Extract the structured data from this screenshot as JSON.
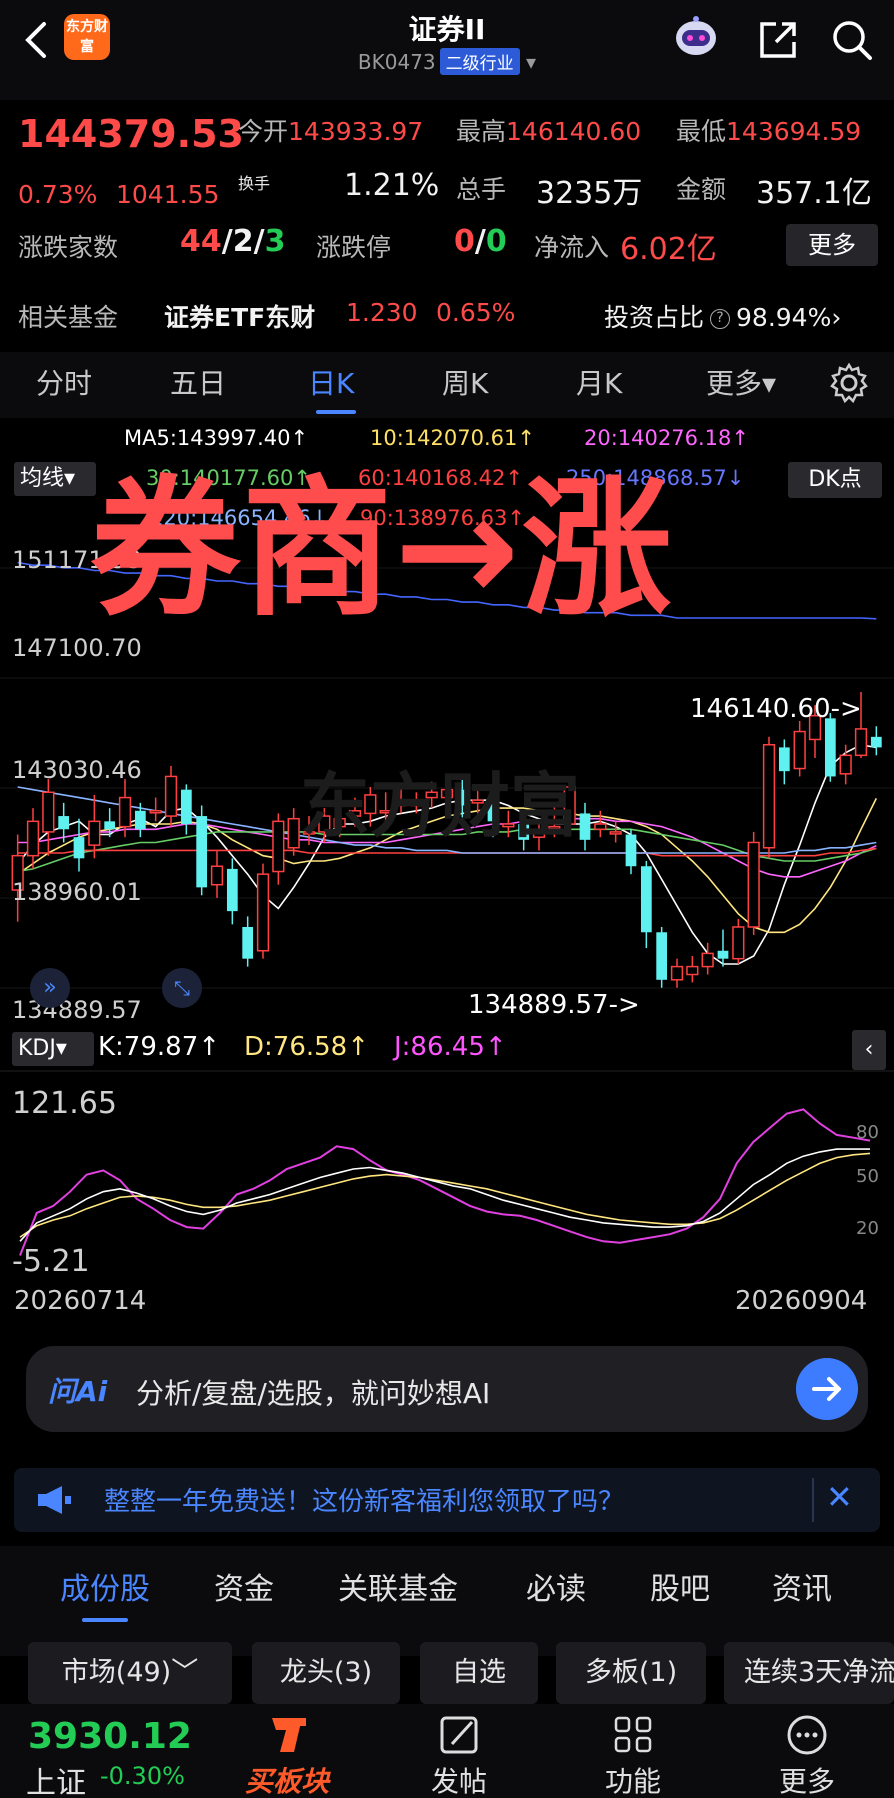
{
  "header": {
    "title": "证券II",
    "code": "BK0473",
    "tag": "二级行业",
    "logo_text": "东方财富"
  },
  "quote": {
    "price": "144379.53",
    "change_pct": "0.73%",
    "change_abs": "1041.55",
    "open_label": "今开",
    "open": "143933.97",
    "high_label": "最高",
    "high": "146140.60",
    "low_label": "最低",
    "low": "143694.59",
    "turnover_label": "换手",
    "turnover": "1.21%",
    "volume_label": "总手",
    "volume": "3235万",
    "amount_label": "金额",
    "amount": "357.1亿",
    "updown_label": "涨跌家数",
    "up": "44",
    "sep1": "/",
    "flat": "2",
    "sep2": "/",
    "down": "3",
    "limit_label": "涨跌停",
    "limit_up": "0",
    "sep3": "/",
    "limit_down": "0",
    "inflow_label": "净流入",
    "inflow": "6.02亿",
    "more_label": "更多",
    "fund_label": "相关基金",
    "fund_name": "证券ETF东财",
    "fund_price": "1.230",
    "fund_pct": "0.65%",
    "ratio_label": "投资占比",
    "ratio_q": "?",
    "ratio": "98.94%",
    "ratio_arrow": "›"
  },
  "period_tabs": [
    "分时",
    "五日",
    "日K",
    "周K",
    "月K",
    "更多▾"
  ],
  "chart": {
    "avg_label": "均线▾",
    "dk_label": "DK点",
    "ma_row1": [
      "MA5:143997.40↑",
      "10:142070.61↑",
      "20:140276.18↑"
    ],
    "ma_row2": [
      "30:140177.60↑",
      "60:140168.42↑",
      "250:148868.57↓"
    ],
    "ma_row3": [
      "120:146654.46↓",
      "90:138976.63↑"
    ],
    "y_labels": [
      "151171.53",
      "147100.70",
      "143030.46",
      "138960.01",
      "134889.57"
    ],
    "high_marker": "146140.60->",
    "low_marker": "134889.57->",
    "overlay": "券商→涨",
    "watermark": "东方财富"
  },
  "kdj": {
    "btn_label": "KDJ▾",
    "k": "K:79.87↑",
    "d": "D:76.58↑",
    "j": "J:86.45↑",
    "y_top": "121.65",
    "y_bottom": "-5.21",
    "levels": [
      "80",
      "50",
      "20"
    ],
    "date_start": "20260714",
    "date_end": "20260904"
  },
  "chart_data": {
    "type": "candlestick",
    "ylim": [
      134889.57,
      151171.53
    ],
    "candles": [
      {
        "o": 138600,
        "c": 139900,
        "h": 140700,
        "l": 137400
      },
      {
        "o": 139900,
        "c": 141200,
        "h": 141700,
        "l": 139400
      },
      {
        "o": 140800,
        "c": 142300,
        "h": 142800,
        "l": 139900
      },
      {
        "o": 141400,
        "c": 140900,
        "h": 141900,
        "l": 140400
      },
      {
        "o": 140600,
        "c": 139800,
        "h": 141300,
        "l": 139300
      },
      {
        "o": 140300,
        "c": 141200,
        "h": 142200,
        "l": 139800
      },
      {
        "o": 141200,
        "c": 140900,
        "h": 141700,
        "l": 140600
      },
      {
        "o": 141000,
        "c": 142100,
        "h": 142800,
        "l": 140600
      },
      {
        "o": 141600,
        "c": 140900,
        "h": 141900,
        "l": 140600
      },
      {
        "o": 141600,
        "c": 141600,
        "h": 142100,
        "l": 141200
      },
      {
        "o": 141400,
        "c": 142900,
        "h": 143300,
        "l": 141000
      },
      {
        "o": 142400,
        "c": 141100,
        "h": 142600,
        "l": 140700
      },
      {
        "o": 141400,
        "c": 138700,
        "h": 141800,
        "l": 138400
      },
      {
        "o": 138800,
        "c": 139500,
        "h": 140100,
        "l": 138300
      },
      {
        "o": 139400,
        "c": 137800,
        "h": 139800,
        "l": 137300
      },
      {
        "o": 137200,
        "c": 136000,
        "h": 137600,
        "l": 135700
      },
      {
        "o": 136300,
        "c": 139200,
        "h": 139600,
        "l": 136000
      },
      {
        "o": 139300,
        "c": 141200,
        "h": 141500,
        "l": 138800
      },
      {
        "o": 140200,
        "c": 141300,
        "h": 141700,
        "l": 139900
      },
      {
        "o": 140800,
        "c": 140800,
        "h": 141400,
        "l": 140300
      },
      {
        "o": 140800,
        "c": 141400,
        "h": 141700,
        "l": 140400
      },
      {
        "o": 141000,
        "c": 141300,
        "h": 142200,
        "l": 140600
      },
      {
        "o": 141400,
        "c": 141600,
        "h": 142100,
        "l": 141000
      },
      {
        "o": 141500,
        "c": 142200,
        "h": 142500,
        "l": 141000
      },
      {
        "o": 141600,
        "c": 141600,
        "h": 142300,
        "l": 141200
      },
      {
        "o": 141800,
        "c": 142000,
        "h": 142600,
        "l": 141500
      },
      {
        "o": 141800,
        "c": 141900,
        "h": 142300,
        "l": 141500
      },
      {
        "o": 142100,
        "c": 142300,
        "h": 142700,
        "l": 141700
      },
      {
        "o": 142100,
        "c": 142400,
        "h": 142900,
        "l": 141800
      },
      {
        "o": 142400,
        "c": 141800,
        "h": 142800,
        "l": 141300
      },
      {
        "o": 141900,
        "c": 142000,
        "h": 142600,
        "l": 141500
      },
      {
        "o": 142000,
        "c": 141200,
        "h": 142300,
        "l": 140600
      },
      {
        "o": 141000,
        "c": 141100,
        "h": 141600,
        "l": 140600
      },
      {
        "o": 141100,
        "c": 140500,
        "h": 141400,
        "l": 140100
      },
      {
        "o": 140600,
        "c": 140900,
        "h": 141300,
        "l": 140100
      },
      {
        "o": 141000,
        "c": 141000,
        "h": 141800,
        "l": 140600
      },
      {
        "o": 141100,
        "c": 142500,
        "h": 142900,
        "l": 140900
      },
      {
        "o": 141500,
        "c": 140500,
        "h": 141900,
        "l": 140100
      },
      {
        "o": 140900,
        "c": 141100,
        "h": 141600,
        "l": 140600
      },
      {
        "o": 140800,
        "c": 140800,
        "h": 141200,
        "l": 140400
      },
      {
        "o": 140700,
        "c": 139500,
        "h": 140900,
        "l": 139200
      },
      {
        "o": 139500,
        "c": 137000,
        "h": 139700,
        "l": 136400
      },
      {
        "o": 137000,
        "c": 135200,
        "h": 137200,
        "l": 134900
      },
      {
        "o": 135200,
        "c": 135700,
        "h": 136000,
        "l": 134900
      },
      {
        "o": 135400,
        "c": 135700,
        "h": 136100,
        "l": 135100
      },
      {
        "o": 135700,
        "c": 136200,
        "h": 136600,
        "l": 135400
      },
      {
        "o": 136300,
        "c": 136000,
        "h": 137100,
        "l": 135700
      },
      {
        "o": 136000,
        "c": 137200,
        "h": 137500,
        "l": 135800
      },
      {
        "o": 137200,
        "c": 140400,
        "h": 140800,
        "l": 136900
      },
      {
        "o": 140200,
        "c": 144100,
        "h": 144400,
        "l": 139800
      },
      {
        "o": 144000,
        "c": 143100,
        "h": 144300,
        "l": 142600
      },
      {
        "o": 143200,
        "c": 144600,
        "h": 145000,
        "l": 142900
      },
      {
        "o": 144300,
        "c": 145200,
        "h": 145600,
        "l": 143600
      },
      {
        "o": 145100,
        "c": 142900,
        "h": 145300,
        "l": 142700
      },
      {
        "o": 143000,
        "c": 143700,
        "h": 144100,
        "l": 142600
      },
      {
        "o": 143700,
        "c": 144700,
        "h": 146100,
        "l": 143600
      },
      {
        "o": 144400,
        "c": 144000,
        "h": 144800,
        "l": 143700
      }
    ],
    "ma_lines": [
      {
        "name": "MA5",
        "color": "#ffffff",
        "values": [
          139600,
          140300,
          140800,
          141000,
          141200,
          140700,
          140700,
          141100,
          141300,
          141000,
          141600,
          141700,
          141200,
          140600,
          139900,
          139200,
          138400,
          137900,
          138700,
          139600,
          140600,
          141100,
          141100,
          141200,
          141400,
          141500,
          141600,
          141700,
          141900,
          142000,
          142000,
          142000,
          141800,
          141500,
          141300,
          141100,
          141100,
          141100,
          141200,
          141000,
          140700,
          140000,
          139000,
          138000,
          137000,
          136200,
          135800,
          135800,
          136100,
          137100,
          138800,
          140300,
          141900,
          143300,
          143800,
          144100,
          143997
        ]
      },
      {
        "name": "MA10",
        "color": "#ffe680",
        "values": [
          139200,
          139600,
          140000,
          140300,
          140600,
          140800,
          140900,
          141000,
          141100,
          141100,
          141100,
          141200,
          141100,
          140900,
          140500,
          140200,
          139900,
          139800,
          139600,
          139700,
          139700,
          139800,
          140000,
          140200,
          140500,
          140800,
          141000,
          141200,
          141400,
          141500,
          141600,
          141700,
          141700,
          141700,
          141600,
          141600,
          141500,
          141400,
          141400,
          141300,
          141200,
          141000,
          140700,
          140200,
          139700,
          139100,
          138400,
          137700,
          137200,
          137000,
          137000,
          137300,
          137900,
          138700,
          139700,
          140900,
          142070
        ]
      },
      {
        "name": "MA20",
        "color": "#ff66ff",
        "values": [
          140400,
          140400,
          140500,
          140600,
          140700,
          140800,
          140800,
          140900,
          140900,
          140900,
          141000,
          141100,
          141100,
          141000,
          140900,
          140800,
          140700,
          140600,
          140500,
          140500,
          140400,
          140400,
          140400,
          140400,
          140400,
          140500,
          140600,
          140700,
          140800,
          140900,
          141000,
          141100,
          141100,
          141200,
          141200,
          141200,
          141300,
          141300,
          141300,
          141200,
          141200,
          141100,
          141000,
          140800,
          140600,
          140300,
          140000,
          139700,
          139400,
          139200,
          139100,
          139100,
          139300,
          139500,
          139700,
          140000,
          140276
        ]
      },
      {
        "name": "MA30",
        "color": "#66cc66",
        "values": [
          139300,
          139400,
          139600,
          139800,
          140000,
          140100,
          140200,
          140300,
          140400,
          140400,
          140500,
          140600,
          140700,
          140800,
          140800,
          140800,
          140800,
          140800,
          140800,
          140800,
          140700,
          140700,
          140700,
          140700,
          140700,
          140700,
          140700,
          140700,
          140700,
          140700,
          140800,
          140800,
          140800,
          140900,
          140900,
          140900,
          140900,
          140900,
          140900,
          140900,
          140900,
          140800,
          140700,
          140600,
          140500,
          140400,
          140300,
          140100,
          139900,
          139800,
          139700,
          139700,
          139700,
          139800,
          139900,
          140000,
          140177
        ]
      },
      {
        "name": "MA60",
        "color": "#ff4040",
        "values": [
          140000,
          140000,
          140000,
          140000,
          140100,
          140100,
          140100,
          140100,
          140100,
          140100,
          140100,
          140100,
          140100,
          140100,
          140100,
          140100,
          140100,
          140100,
          140100,
          140000,
          140000,
          140000,
          140000,
          140000,
          140000,
          140000,
          140000,
          140000,
          140000,
          140000,
          140000,
          140000,
          140000,
          140000,
          140000,
          140000,
          140000,
          140000,
          140000,
          140000,
          140000,
          140000,
          139900,
          139900,
          139900,
          139900,
          139900,
          139900,
          139900,
          139900,
          139900,
          139900,
          139900,
          140000,
          140000,
          140100,
          140168
        ]
      },
      {
        "name": "MA120",
        "color": "#8ab4ff",
        "values": [
          142500,
          142400,
          142300,
          142200,
          142100,
          142000,
          141900,
          141800,
          141700,
          141600,
          141500,
          141400,
          141300,
          141200,
          141100,
          141000,
          140900,
          140800,
          140700,
          140600,
          140500,
          140400,
          140300,
          140300,
          140200,
          140200,
          140100,
          140100,
          140100,
          140000,
          140000,
          140000,
          140000,
          140000,
          140000,
          140000,
          140000,
          140000,
          140000,
          140000,
          140000,
          140000,
          140000,
          140000,
          140000,
          140000,
          140000,
          140000,
          140000,
          140000,
          140000,
          140100,
          140100,
          140200,
          140200,
          140300,
          140400
        ]
      },
      {
        "name": "MA250",
        "color": "#4466ff",
        "values": [
          151000,
          150900,
          150900,
          150800,
          150800,
          150700,
          150700,
          150600,
          150600,
          150500,
          150500,
          150400,
          150400,
          150300,
          150300,
          150200,
          150200,
          150100,
          150100,
          150000,
          150000,
          149900,
          149900,
          149800,
          149800,
          149700,
          149700,
          149600,
          149600,
          149500,
          149500,
          149400,
          149400,
          149300,
          149300,
          149200,
          149200,
          149100,
          149100,
          149100,
          149000,
          149000,
          149000,
          148900,
          148900,
          148900,
          148900,
          148900,
          148900,
          148900,
          148900,
          148900,
          148900,
          148900,
          148900,
          148900,
          148868
        ]
      }
    ],
    "kdj": {
      "ylim": [
        -5.21,
        121.65
      ],
      "k": [
        15,
        28,
        33,
        38,
        45,
        50,
        52,
        49,
        45,
        40,
        36,
        34,
        37,
        42,
        45,
        48,
        52,
        56,
        60,
        63,
        66,
        67,
        65,
        63,
        60,
        57,
        54,
        52,
        48,
        44,
        41,
        38,
        35,
        32,
        30,
        28,
        27,
        26,
        25,
        25,
        26,
        29,
        35,
        45,
        55,
        62,
        70,
        75,
        78,
        80,
        80,
        80
      ],
      "d": [
        18,
        26,
        30,
        33,
        38,
        42,
        46,
        47,
        46,
        44,
        41,
        39,
        39,
        40,
        42,
        44,
        47,
        50,
        53,
        56,
        59,
        61,
        62,
        61,
        60,
        58,
        56,
        54,
        52,
        49,
        46,
        43,
        40,
        37,
        34,
        32,
        30,
        29,
        28,
        27,
        27,
        28,
        31,
        37,
        44,
        51,
        58,
        64,
        70,
        74,
        76,
        77
      ],
      "j": [
        5,
        35,
        40,
        50,
        62,
        65,
        58,
        45,
        38,
        30,
        25,
        24,
        35,
        48,
        52,
        58,
        66,
        70,
        74,
        82,
        80,
        72,
        65,
        62,
        58,
        52,
        46,
        40,
        36,
        34,
        33,
        30,
        26,
        22,
        18,
        15,
        14,
        16,
        18,
        20,
        24,
        32,
        45,
        70,
        85,
        95,
        105,
        108,
        98,
        90,
        88,
        86
      ]
    }
  },
  "ai_bar": {
    "logo": "问Ai",
    "text": "分析/复盘/选股，就问妙想AI"
  },
  "promo": {
    "text": "整整一年免费送！这份新客福利您领取了吗？"
  },
  "bottom_tabs": [
    "成份股",
    "资金",
    "关联基金",
    "必读",
    "股吧",
    "资讯"
  ],
  "chips": [
    "市场(49)﹀",
    "龙头(3)",
    "自选",
    "多板(1)",
    "连续3天净流"
  ],
  "bottom_nav": {
    "index_value": "3930.12",
    "index_name": "上证",
    "index_change": "-0.30%",
    "items": [
      "买板块",
      "发帖",
      "功能",
      "更多"
    ]
  }
}
